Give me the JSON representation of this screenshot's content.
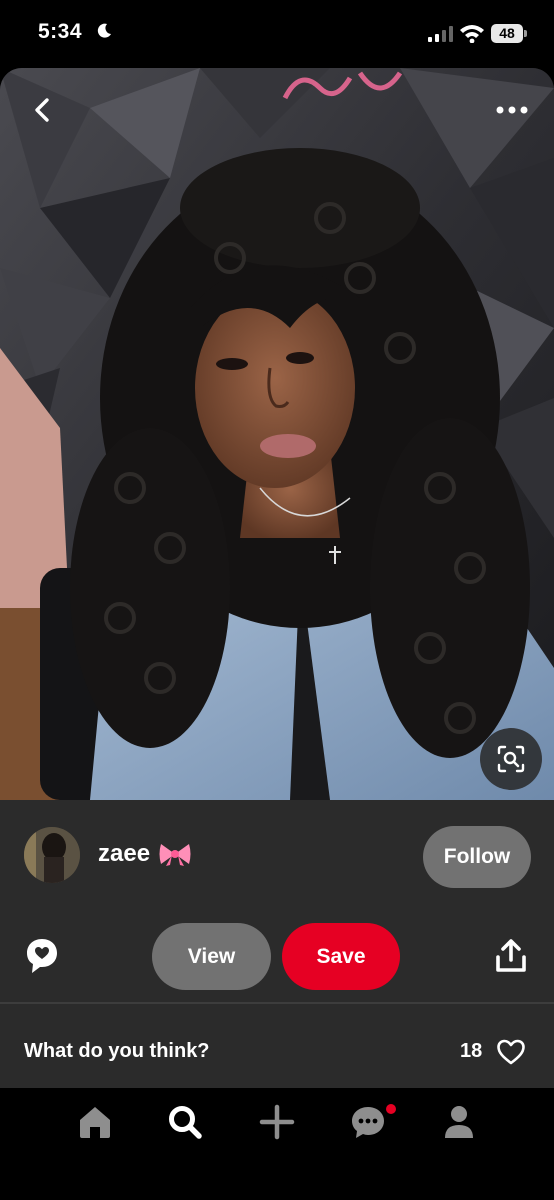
{
  "status_bar": {
    "time": "5:34",
    "battery_level": "48",
    "icons": [
      "moon-icon",
      "signal-icon",
      "wifi-icon",
      "battery-icon"
    ]
  },
  "photo": {
    "actions": [
      "back-arrow-icon",
      "more-options-icon",
      "visual-search-icon"
    ]
  },
  "pin": {
    "username": "zaee",
    "username_emoji": "bow-icon",
    "follow_label": "Follow",
    "view_label": "View",
    "save_label": "Save",
    "comment_prompt": "What do you think?",
    "like_count": "18"
  },
  "bottom_nav": {
    "items": [
      "home-icon",
      "search-icon",
      "create-icon",
      "messages-icon",
      "profile-icon"
    ],
    "active": "search-icon",
    "has_notification": true
  },
  "colors": {
    "brand_red": "#e60023",
    "panel_bg": "#2b2b2b",
    "button_gray": "#727272",
    "nav_icon_gray": "#8e8e8e"
  }
}
